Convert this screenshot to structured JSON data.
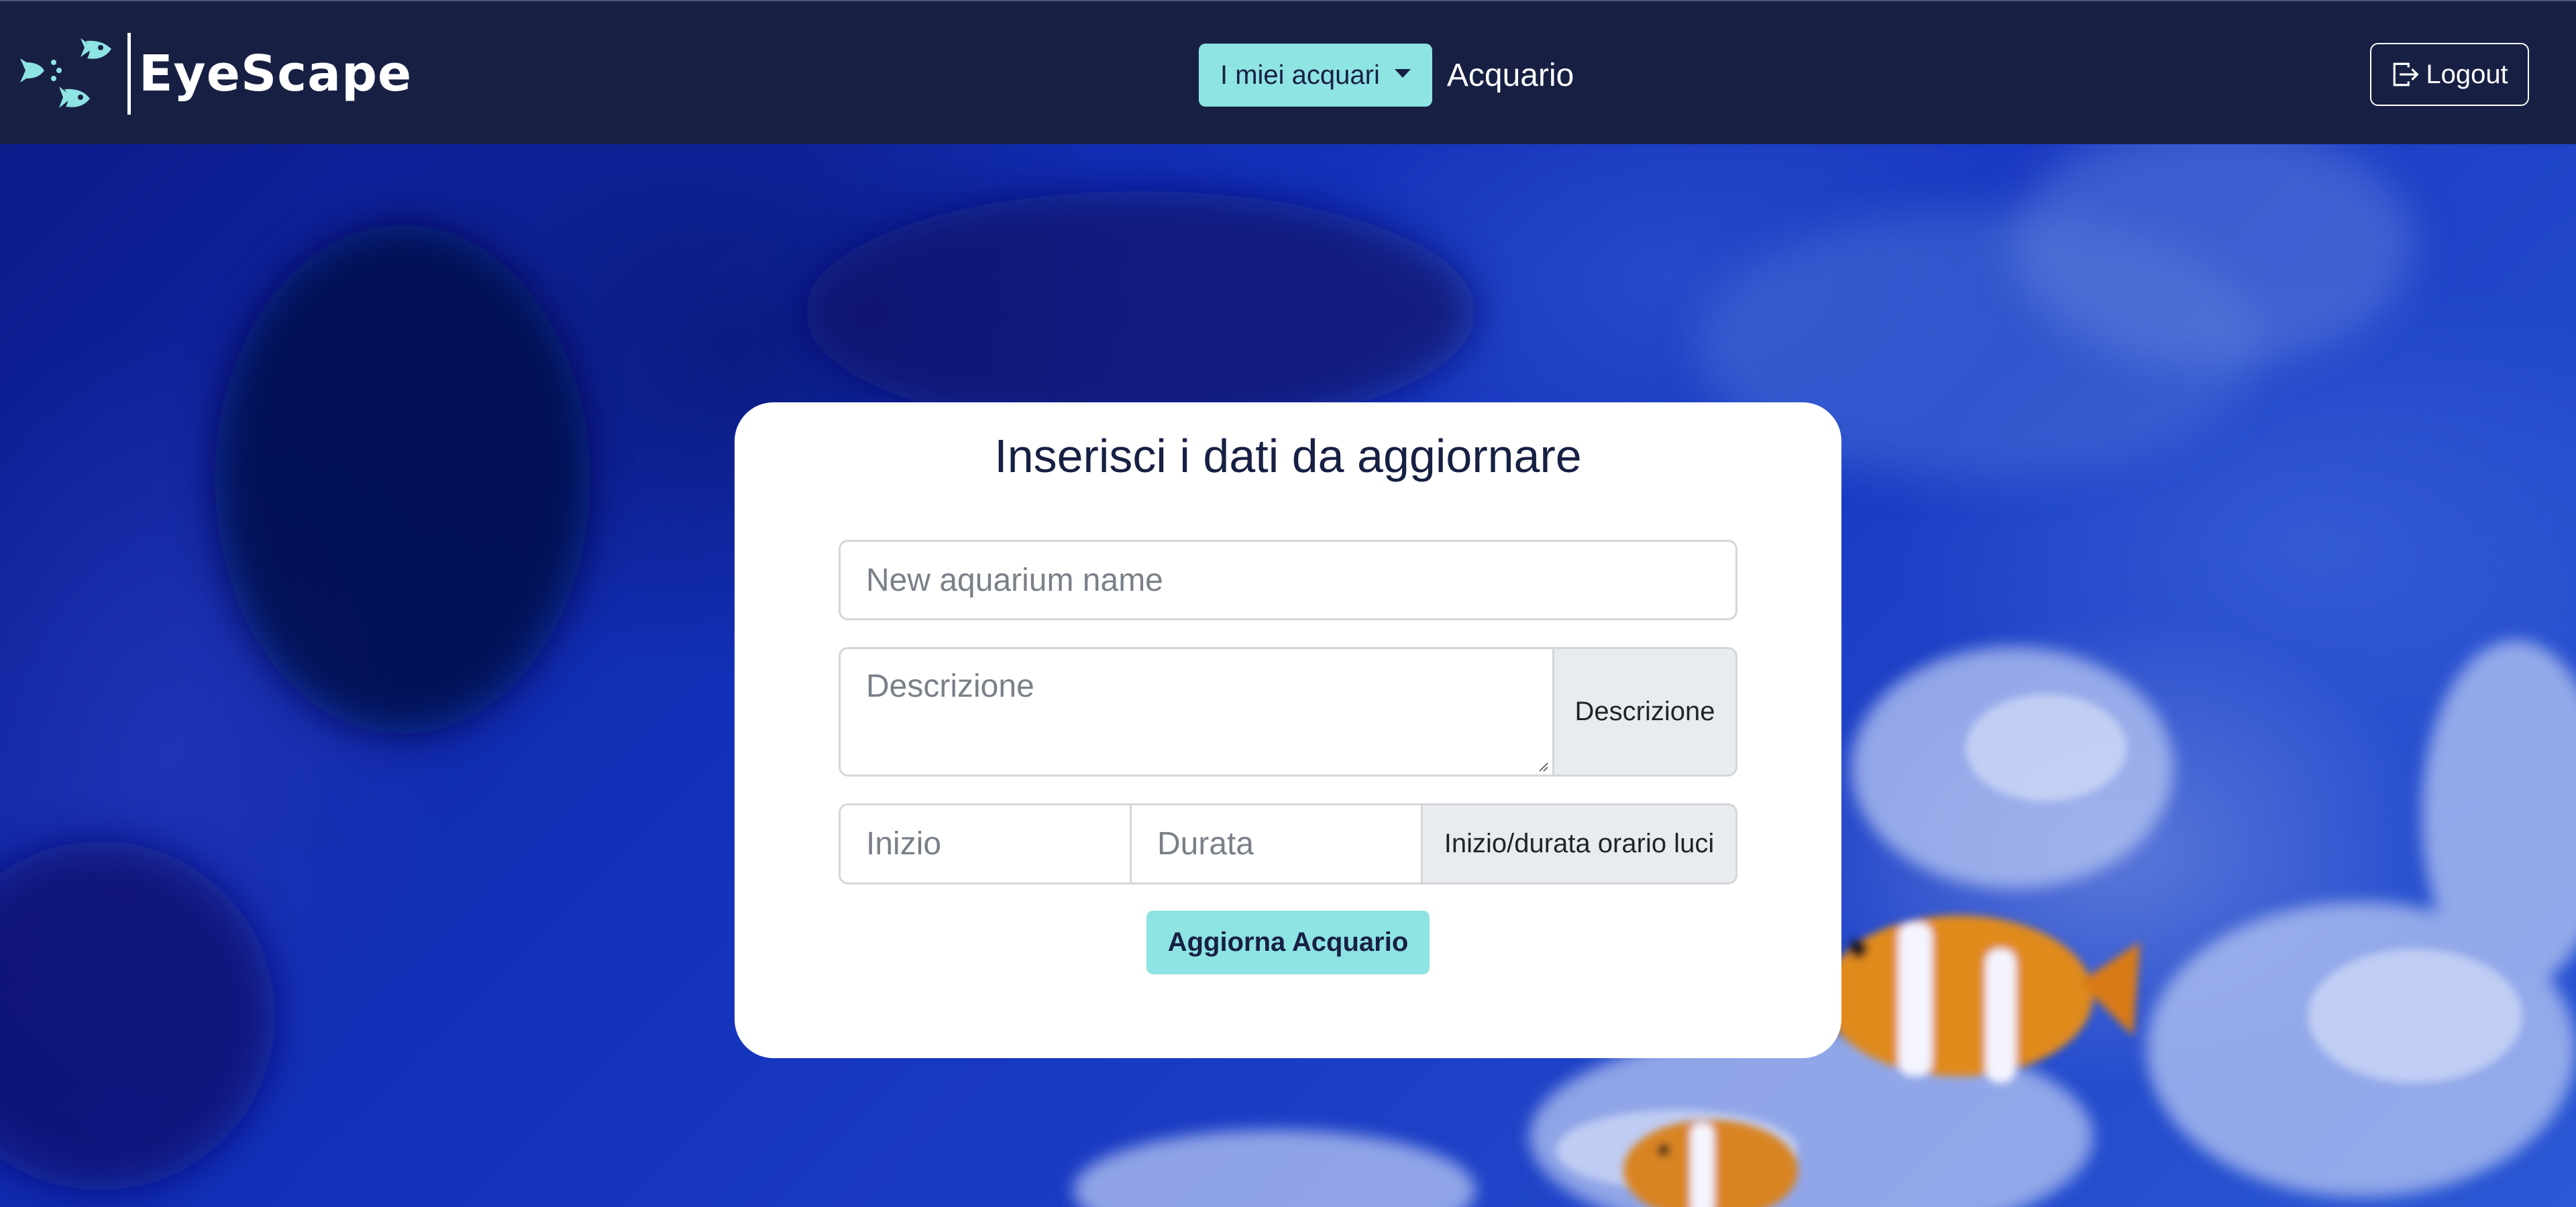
{
  "navbar": {
    "brand_name": "EyeScape",
    "brand_logo_icon": "fish-school-icon",
    "dropdown_label": "I miei acquari",
    "link_label": "Acquario",
    "logout_label": "Logout",
    "logout_icon": "box-arrow-right-icon"
  },
  "form": {
    "title": "Inserisci i dati da aggiornare",
    "name_placeholder": "New aquarium name",
    "name_value": "",
    "description_placeholder": "Descrizione",
    "description_value": "",
    "description_addon": "Descrizione",
    "start_placeholder": "Inizio",
    "start_value": "",
    "duration_placeholder": "Durata",
    "duration_value": "",
    "lights_addon": "Inizio/durata orario luci",
    "submit_label": "Aggiorna Acquario"
  },
  "colors": {
    "navbar_bg": "#172043",
    "accent": "#8ee3e3",
    "card_bg": "#ffffff",
    "addon_bg": "#e9ecef"
  }
}
